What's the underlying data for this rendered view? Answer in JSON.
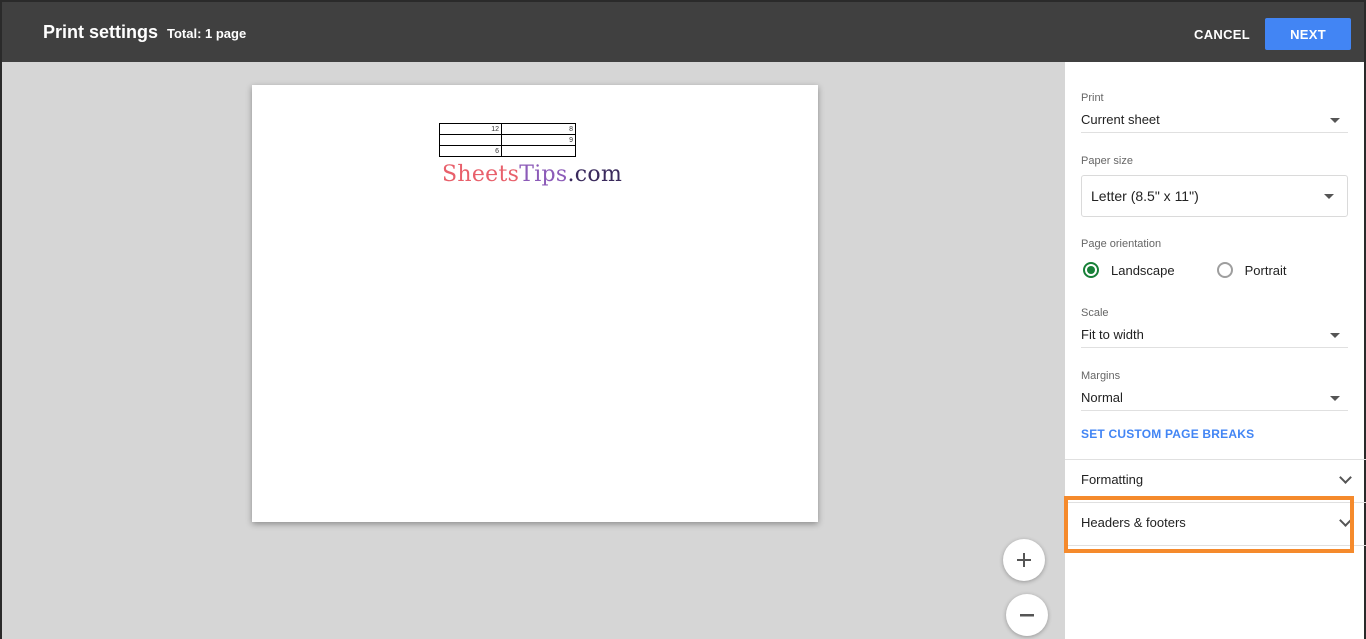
{
  "header": {
    "title": "Print settings",
    "total": "Total: 1 page",
    "cancel_label": "CANCEL",
    "next_label": "NEXT"
  },
  "preview": {
    "table_rows": [
      [
        "12",
        "8"
      ],
      [
        "",
        "9"
      ],
      [
        "6",
        ""
      ]
    ],
    "watermark": {
      "part1": "Sheets",
      "part2": "Tips",
      "part3": ".com"
    },
    "zoom_in_icon": "plus-icon",
    "zoom_out_icon": "minus-icon"
  },
  "panel": {
    "print": {
      "label": "Print",
      "value": "Current sheet"
    },
    "paper_size": {
      "label": "Paper size",
      "value": "Letter (8.5\" x 11\")"
    },
    "orientation": {
      "label": "Page orientation",
      "options": [
        "Landscape",
        "Portrait"
      ],
      "selected": "Landscape"
    },
    "scale": {
      "label": "Scale",
      "value": "Fit to width"
    },
    "margins": {
      "label": "Margins",
      "value": "Normal"
    },
    "custom_breaks_label": "SET CUSTOM PAGE BREAKS",
    "formatting_label": "Formatting",
    "headers_footers_label": "Headers & footers"
  },
  "colors": {
    "topbar": "#404040",
    "accent": "#4285f4",
    "radio_selected": "#188038",
    "highlight": "#f58a2c"
  }
}
